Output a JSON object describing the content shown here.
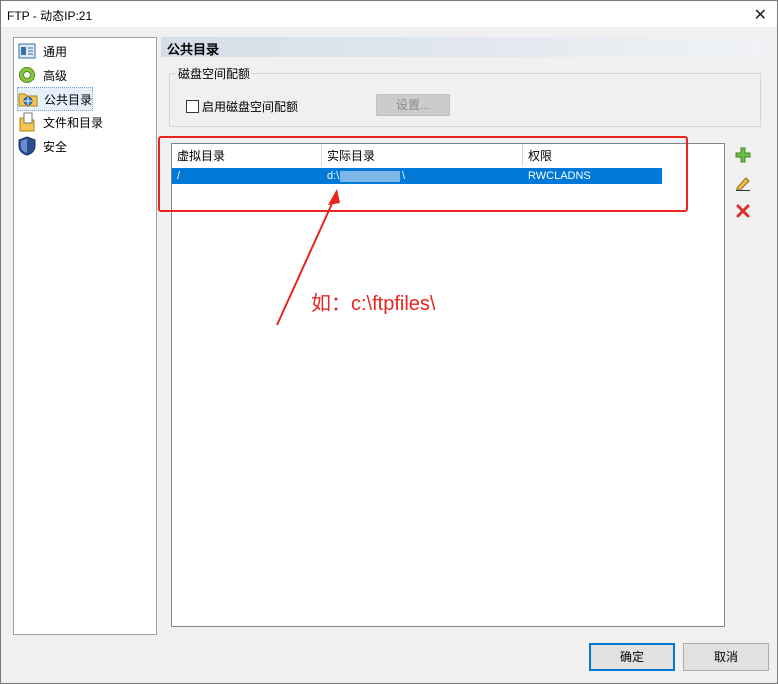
{
  "window": {
    "title": "FTP - 动态IP:21",
    "close_glyph": "✕"
  },
  "sidebar": {
    "items": [
      {
        "label": "通用",
        "icon": "general-icon"
      },
      {
        "label": "高级",
        "icon": "gear-icon"
      },
      {
        "label": "公共目录",
        "icon": "folder-network-icon",
        "selected": true
      },
      {
        "label": "文件和目录",
        "icon": "files-icon"
      },
      {
        "label": "安全",
        "icon": "shield-icon"
      }
    ]
  },
  "page": {
    "title": "公共目录",
    "quota": {
      "group_label": "磁盘空间配额",
      "checkbox_label": "启用磁盘空间配额",
      "checked": false,
      "settings_label": "设置..."
    },
    "table": {
      "columns": [
        "虚拟目录",
        "实际目录",
        "权限"
      ],
      "rows": [
        {
          "virtual": "/",
          "actual": "d:\\",
          "actual_tail": "\\",
          "perm": "RWCLADNS"
        }
      ]
    },
    "tools": {
      "add": "add-icon",
      "edit": "edit-icon",
      "delete": "delete-icon"
    }
  },
  "annotation": {
    "text": "如：c:\\ftpfiles\\",
    "color": "#e8251f"
  },
  "footer": {
    "ok_label": "确定",
    "cancel_label": "取消"
  },
  "colors": {
    "accent": "#0078d7",
    "annotation": "#e8251f"
  }
}
